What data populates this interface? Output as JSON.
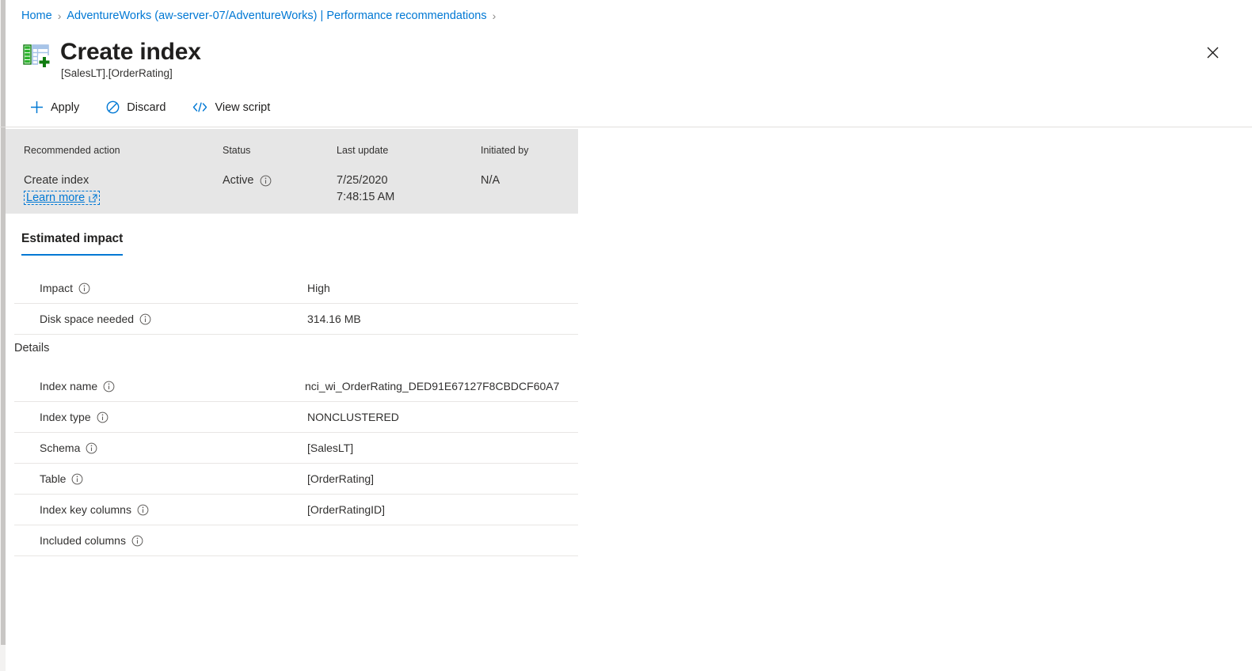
{
  "breadcrumb": {
    "items": [
      {
        "label": "Home"
      },
      {
        "label": "AdventureWorks (aw-server-07/AdventureWorks) | Performance recommendations"
      }
    ],
    "separator": "›"
  },
  "header": {
    "title": "Create index",
    "subtitle": "[SalesLT].[OrderRating]",
    "icon": "create-index-table-icon",
    "close_label": "✕"
  },
  "toolbar": {
    "commands": [
      {
        "label": "Apply",
        "icon": "plus-icon"
      },
      {
        "label": "Discard",
        "icon": "no-entry-icon"
      },
      {
        "label": "View script",
        "icon": "code-brackets-icon"
      }
    ]
  },
  "summary": {
    "headers": {
      "recommended_action": "Recommended action",
      "status": "Status",
      "last_update": "Last update",
      "initiated_by": "Initiated by"
    },
    "recommended_action": "Create index",
    "learn_more": "Learn more",
    "status": "Active",
    "last_update_date": "7/25/2020",
    "last_update_time": "7:48:15 AM",
    "initiated_by": "N/A"
  },
  "tabs": [
    {
      "label": "Estimated impact",
      "active": true
    }
  ],
  "impact": {
    "rows": [
      {
        "label": "Impact",
        "value": "High"
      },
      {
        "label": "Disk space needed",
        "value": "314.16 MB"
      }
    ]
  },
  "details": {
    "section_title": "Details",
    "rows": [
      {
        "label": "Index name",
        "value": "nci_wi_OrderRating_DED91E67127F8CBDCF60A7"
      },
      {
        "label": "Index type",
        "value": "NONCLUSTERED"
      },
      {
        "label": "Schema",
        "value": "[SalesLT]"
      },
      {
        "label": "Table",
        "value": "[OrderRating]"
      },
      {
        "label": "Index key columns",
        "value": "[OrderRatingID]"
      },
      {
        "label": "Included columns",
        "value": ""
      }
    ]
  },
  "colors": {
    "accent": "#0078d4",
    "panel_grey": "#e6e6e6",
    "text": "#323130",
    "divider": "#e8e6e4"
  }
}
